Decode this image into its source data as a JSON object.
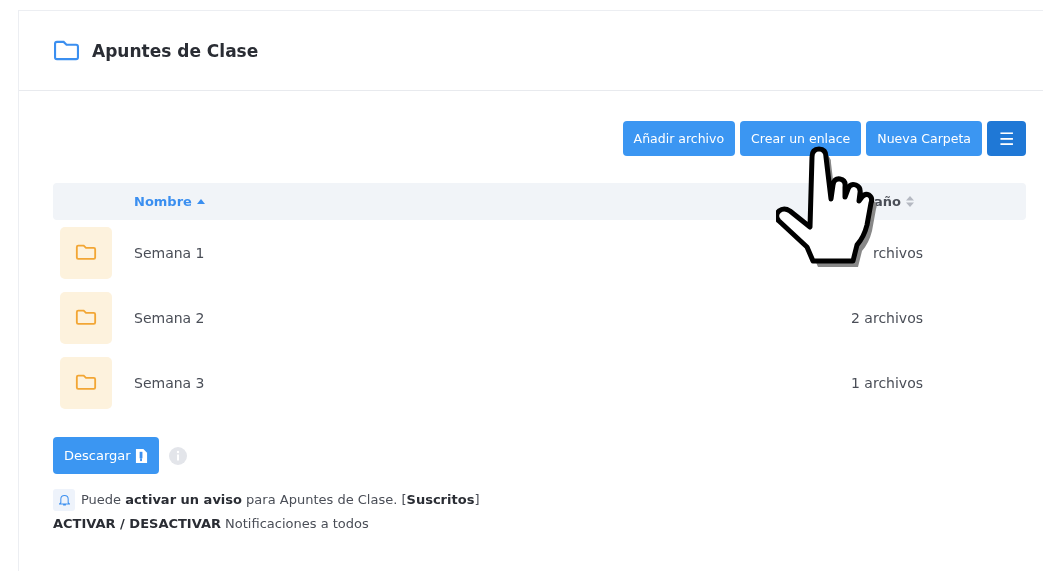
{
  "card": {
    "title": "Apuntes de Clase"
  },
  "toolbar": {
    "buttons": [
      "Añadir archivo",
      "Crear un enlace",
      "Nueva Carpeta"
    ],
    "menu_button": "☰"
  },
  "table": {
    "columns": [
      {
        "label": "Nombre",
        "sorted": true
      },
      {
        "label": "año",
        "sorted": false
      }
    ],
    "rows": [
      {
        "name": "Semana 1",
        "size": "rchivos"
      },
      {
        "name": "Semana 2",
        "size": "2 archivos"
      },
      {
        "name": "Semana 3",
        "size": "1 archivos"
      }
    ]
  },
  "download_button": "Descargar",
  "notice": {
    "lines": [
      "Puede **activar un aviso** para Apuntes de Clase. [**Suscritos**]",
      "**ACTIVAR / DESACTIVAR** Notificaciones a todos"
    ]
  },
  "overlay": {
    "kind": "hand_pointer"
  }
}
